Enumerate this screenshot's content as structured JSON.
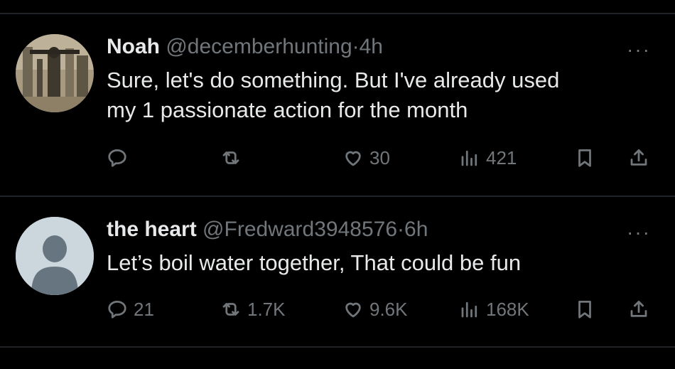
{
  "tweets": [
    {
      "name": "Noah",
      "handle": "@decemberhunting",
      "dot": "·",
      "time": "4h",
      "more": "···",
      "text_line1": "Sure, let's do something. But I've already used",
      "text_line2": "my 1 passionate action for the month",
      "replies": "",
      "retweets": "",
      "likes": "30",
      "views": "421",
      "avatar_type": "photo"
    },
    {
      "name": "the heart",
      "handle": "@Fredward3948576",
      "dot": "·",
      "time": "6h",
      "more": "···",
      "text_line1": "Let’s boil water together, That could be fun",
      "text_line2": "",
      "replies": "21",
      "retweets": "1.7K",
      "likes": "9.6K",
      "views": "168K",
      "avatar_type": "default-profile"
    }
  ],
  "icons": {
    "reply": "reply-icon",
    "retweet": "retweet-icon",
    "like": "heart-icon",
    "views": "views-icon",
    "bookmark": "bookmark-icon",
    "share": "share-icon",
    "more": "more-icon"
  },
  "colors": {
    "background": "#000000",
    "text_primary": "#e7e9ea",
    "text_secondary": "#71767b",
    "divider": "#1f2226"
  }
}
